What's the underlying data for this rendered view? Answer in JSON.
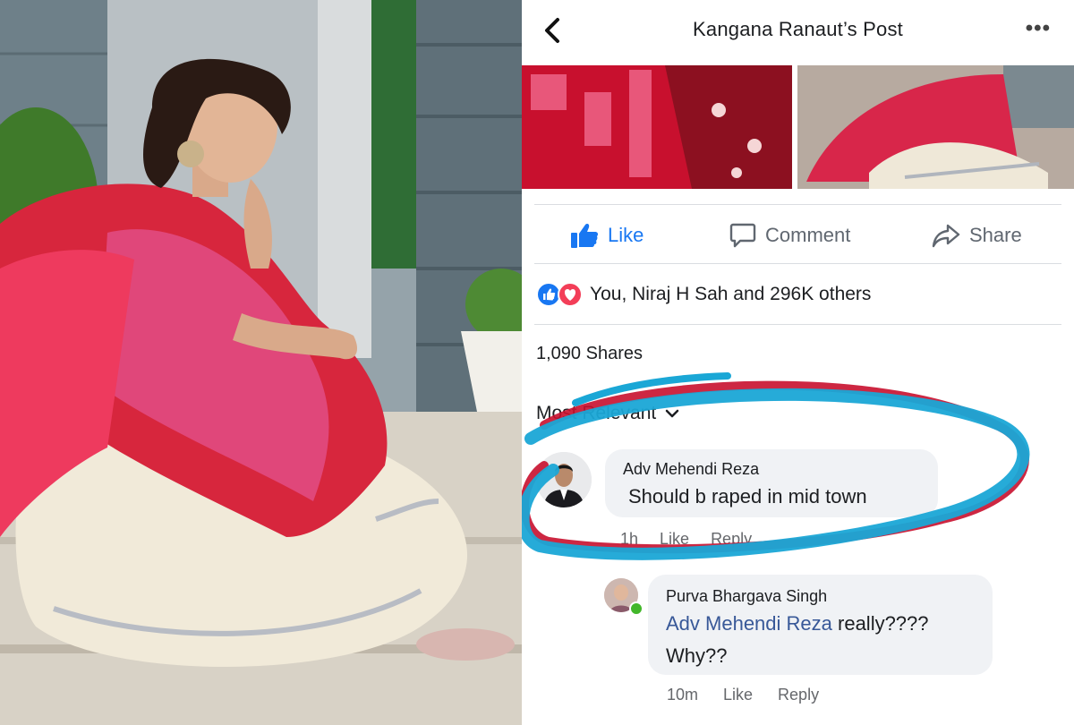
{
  "header": {
    "title": "Kangana Ranaut’s Post",
    "back_icon": "chevron-left-icon",
    "more_label": "•••"
  },
  "actions": {
    "like_label": "Like",
    "comment_label": "Comment",
    "share_label": "Share"
  },
  "reactions": {
    "icons": [
      "like-reaction-icon",
      "love-reaction-icon"
    ],
    "summary": "You, Niraj H Sah and 296K others"
  },
  "shares": {
    "label": "1,090 Shares"
  },
  "comments": {
    "sort_label": "Most Relevant",
    "items": [
      {
        "author": "Adv Mehendi Reza",
        "text": "Should b raped in mid town",
        "time": "1h",
        "like_label": "Like",
        "reply_label": "Reply"
      },
      {
        "author": "Purva Bhargava Singh",
        "mention": "Adv Mehendi Reza",
        "text_after_mention": " really????",
        "text_line2": "Why??",
        "time": "10m",
        "like_label": "Like",
        "reply_label": "Reply"
      }
    ]
  },
  "colors": {
    "facebook_blue": "#1877f2",
    "love_red": "#f33e58",
    "annotation_blue": "#1aa7d6",
    "annotation_red": "#c8102e",
    "bubble_gray": "#f0f2f5"
  }
}
